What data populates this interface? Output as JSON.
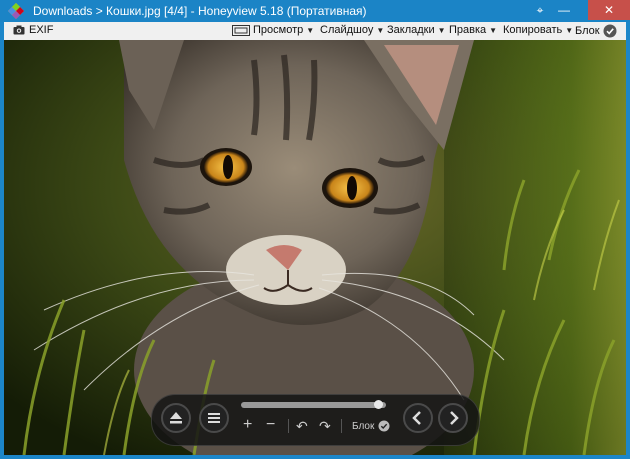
{
  "window": {
    "title": "Downloads  >  Кошки.jpg [4/4]  -  Honeyview 5.18 (Портативная)",
    "controls": {
      "pin": "⌖",
      "minimize": "—",
      "maximize": "☐",
      "close": "✕"
    }
  },
  "menubar": {
    "exif_label": "EXIF",
    "items": [
      {
        "label": "Просмотр",
        "icon": "film-icon"
      },
      {
        "label": "Слайдшоу"
      },
      {
        "label": "Закладки"
      },
      {
        "label": "Правка"
      },
      {
        "label": "Копировать"
      },
      {
        "label": "Блок",
        "icon": "check-circle-icon"
      }
    ]
  },
  "overlay": {
    "zoom_in": "+",
    "zoom_out": "−",
    "rotate_left": "↶",
    "rotate_right": "↷",
    "lock_label": "Блок",
    "progress": 0.98
  },
  "colors": {
    "titlebar": "#1b84c6",
    "menubar": "#f0f0f0",
    "close_button": "#c7504a",
    "overlay": "#141414"
  }
}
